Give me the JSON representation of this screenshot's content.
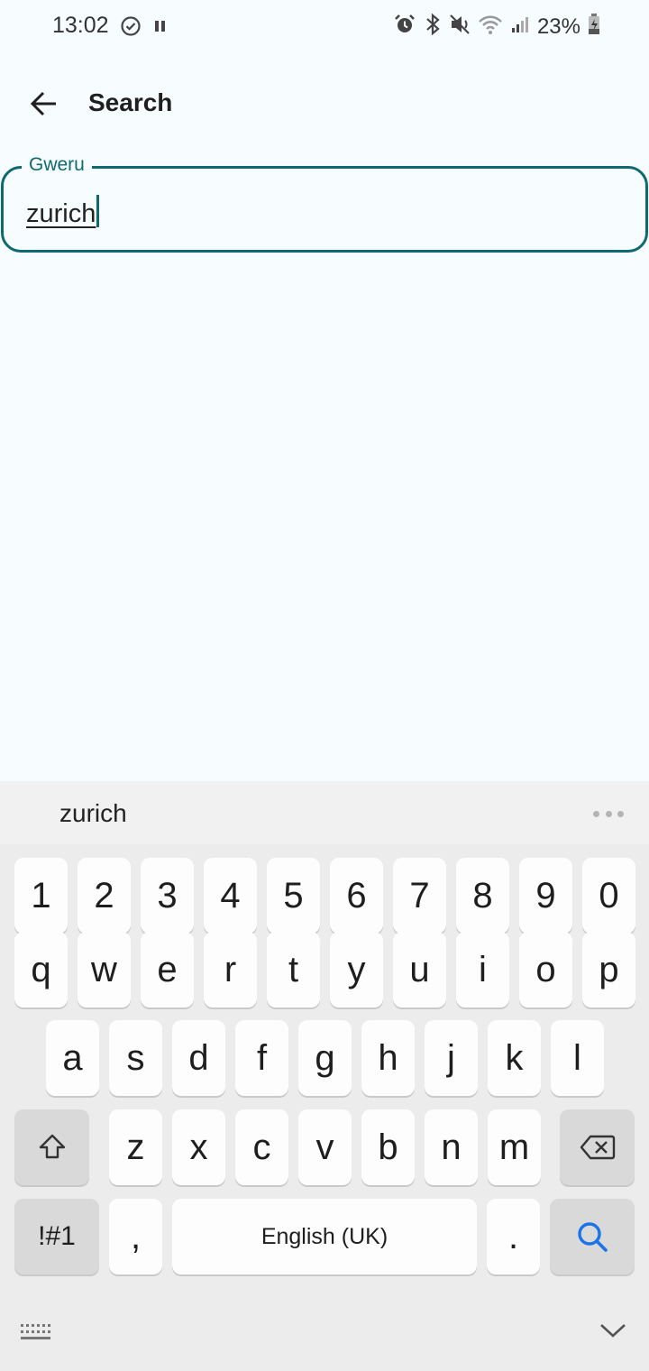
{
  "status_bar": {
    "time": "13:02",
    "battery_percent": "23%",
    "left_icons": [
      "check-circle-icon",
      "pause-icon"
    ],
    "right_icons": [
      "alarm-icon",
      "bluetooth-icon",
      "mute-icon",
      "wifi-icon",
      "signal-icon",
      "battery-charging-icon"
    ]
  },
  "app_bar": {
    "back_icon": "arrow-left-icon",
    "title": "Search"
  },
  "search_field": {
    "label": "Gweru",
    "value": "zurich",
    "accent_color": "#0e6a70"
  },
  "keyboard": {
    "suggestion": "zurich",
    "more_icon": "more-dots-icon",
    "number_row": [
      "1",
      "2",
      "3",
      "4",
      "5",
      "6",
      "7",
      "8",
      "9",
      "0"
    ],
    "row1": [
      "q",
      "w",
      "e",
      "r",
      "t",
      "y",
      "u",
      "i",
      "o",
      "p"
    ],
    "row2": [
      "a",
      "s",
      "d",
      "f",
      "g",
      "h",
      "j",
      "k",
      "l"
    ],
    "row3": [
      "z",
      "x",
      "c",
      "v",
      "b",
      "n",
      "m"
    ],
    "symbols_key": "!#1",
    "comma_key": ",",
    "space_label": "English (UK)",
    "period_key": ".",
    "shift_icon": "shift-icon",
    "backspace_icon": "backspace-icon",
    "search_icon": "search-icon",
    "keyboard_switch_icon": "keyboard-icon",
    "hide_icon": "chevron-down-icon",
    "search_key_color": "#1a73e8"
  }
}
